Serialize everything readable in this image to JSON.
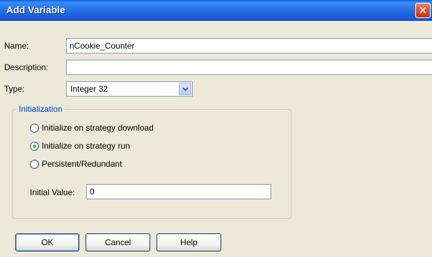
{
  "window": {
    "title": "Add Variable"
  },
  "form": {
    "name_label": "Name:",
    "name_value": "nCookie_Counter",
    "description_label": "Description:",
    "description_value": "",
    "type_label": "Type:",
    "type_value": "Integer 32"
  },
  "initialization": {
    "legend": "Initialization",
    "options": [
      {
        "label": "Initialize on strategy download",
        "selected": false
      },
      {
        "label": "Initialize on strategy run",
        "selected": true
      },
      {
        "label": "Persistent/Redundant",
        "selected": false
      }
    ],
    "initial_value_label": "Initial Value:",
    "initial_value": "0"
  },
  "buttons": {
    "ok": "OK",
    "cancel": "Cancel",
    "help": "Help"
  },
  "icons": {
    "close": "close-icon",
    "dropdown": "chevron-down-icon"
  },
  "colors": {
    "titlebar": "#2a77ec",
    "background": "#ece9d8",
    "group_legend": "#0046d5",
    "close": "#d65534"
  }
}
